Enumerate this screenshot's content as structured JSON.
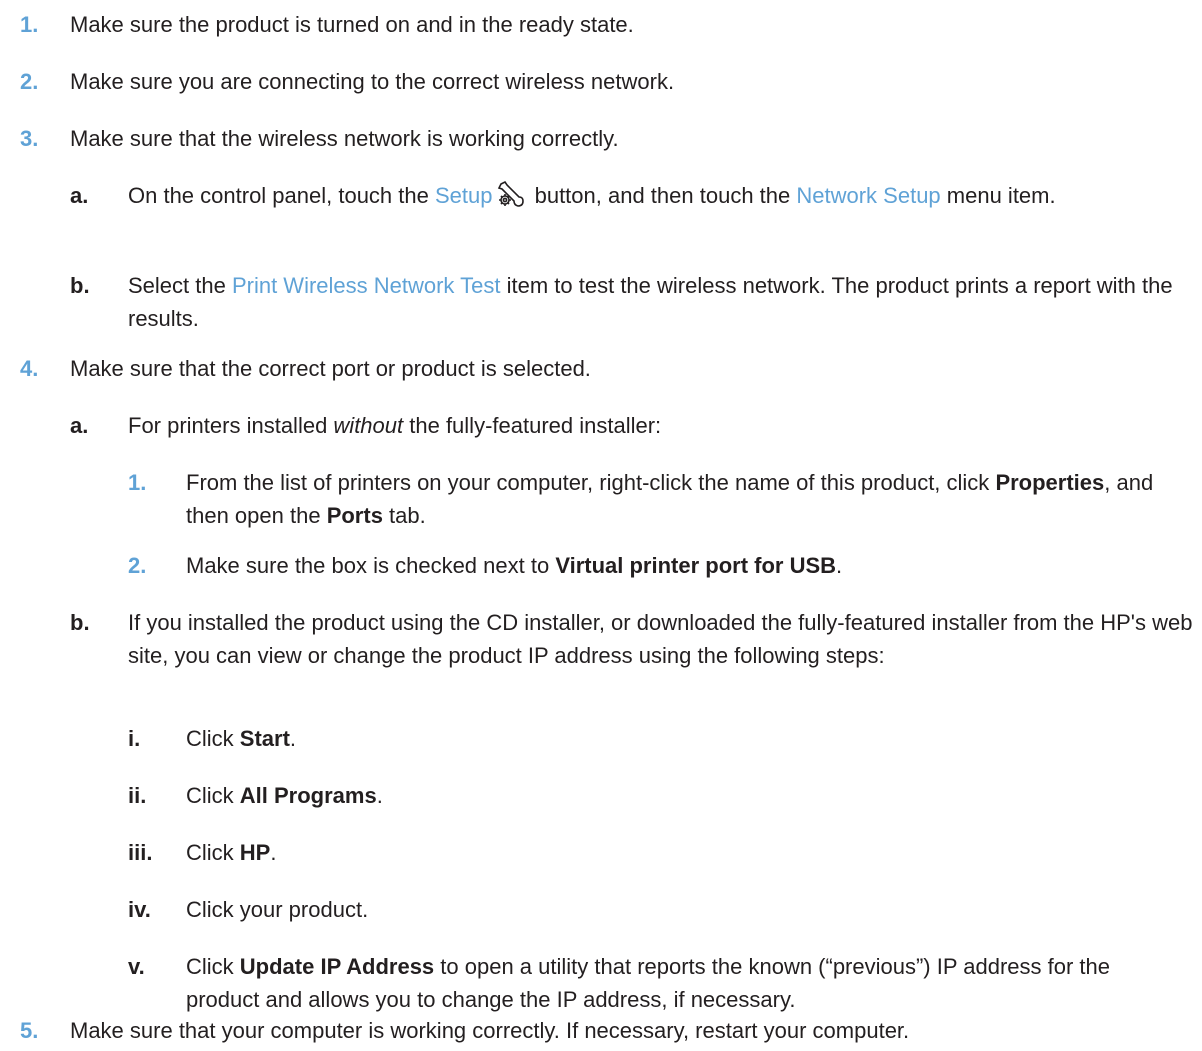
{
  "colors": {
    "text": "#231f20",
    "accent": "#5fa2d6"
  },
  "steps": [
    {
      "num": "1.",
      "text": "Make sure the product is turned on and in the ready state."
    },
    {
      "num": "2.",
      "text": "Make sure you are connecting to the correct wireless network."
    },
    {
      "num": "3.",
      "text": "Make sure that the wireless network is working correctly.",
      "substeps": [
        {
          "num": "a.",
          "pre": "On the control panel, touch the ",
          "link1": "Setup",
          "icon": "setup-wrench-icon",
          "mid": " button, and then touch the ",
          "link2": "Network Setup",
          "post": " menu item."
        },
        {
          "num": "b.",
          "pre": "Select the ",
          "link": "Print Wireless Network Test",
          "post": " item to test the wireless network. The product prints a report with the results."
        }
      ]
    },
    {
      "num": "4.",
      "text": "Make sure that the correct port or product is selected.",
      "substeps": [
        {
          "num": "a.",
          "pre": "For printers installed ",
          "em": "without",
          "post": " the fully-featured installer:",
          "steps": [
            {
              "num": "1.",
              "pre": "From the list of printers on your computer, right-click the name of this product, click ",
              "b1": "Properties",
              "mid": ", and then open the ",
              "b2": "Ports",
              "post": " tab."
            },
            {
              "num": "2.",
              "pre": "Make sure the box is checked next to ",
              "b": "Virtual printer port for USB",
              "post": "."
            }
          ]
        },
        {
          "num": "b.",
          "text": "If you installed the product using the CD installer, or downloaded the fully-featured installer from the HP's web site, you can view or change the product IP address using the following steps:",
          "steps": [
            {
              "num": "i.",
              "pre": "Click ",
              "b": "Start",
              "post": "."
            },
            {
              "num": "ii.",
              "pre": "Click ",
              "b": "All Programs",
              "post": "."
            },
            {
              "num": "iii.",
              "pre": "Click ",
              "b": "HP",
              "post": "."
            },
            {
              "num": "iv.",
              "text": "Click your product."
            },
            {
              "num": "v.",
              "pre": "Click ",
              "b": "Update IP Address",
              "post": " to open a utility that reports the known (“previous”) IP address for the product and allows you to change the IP address, if necessary."
            }
          ]
        }
      ]
    },
    {
      "num": "5.",
      "text": "Make sure that your computer is working correctly. If necessary, restart your computer."
    }
  ]
}
